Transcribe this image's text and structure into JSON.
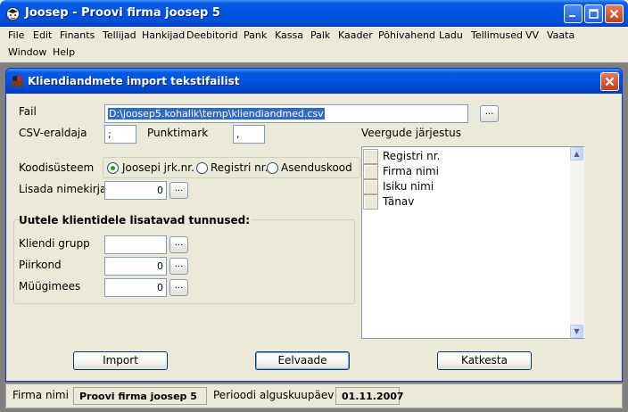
{
  "window": {
    "title": "Joosep - Proovi firma joosep 5"
  },
  "menu": {
    "row1": [
      "File",
      "Edit",
      "Finants",
      "Tellijad",
      "Hankijad",
      "Deebitorid",
      "Pank",
      "Kassa",
      "Palk",
      "Kaader",
      "Põhivahend",
      "Ladu",
      "Tellimused",
      "VV",
      "Vaata"
    ],
    "row2": [
      "Window",
      "Help"
    ]
  },
  "dialog": {
    "title": "Kliendiandmete import tekstifailist",
    "fail_label": "Fail",
    "fail_value": "D:\\joosep5.kohalik\\temp\\kliendiandmed.csv",
    "csv_label": "CSV-eraldaja",
    "csv_value": ";",
    "punkt_label": "Punktimark",
    "punkt_value": ",",
    "kood_label": "Koodisüsteem",
    "kood_options": [
      "Joosepi jrk.nr.",
      "Registri nr.",
      "Asenduskood"
    ],
    "kood_selected": "Joosepi jrk.nr.",
    "nimekiri_label": "Lisada nimekirja",
    "nimekiri_value": "0",
    "group_title": "Uutele klientidele lisatavad tunnused:",
    "grupp_label": "Kliendi grupp",
    "grupp_value": "",
    "piirkond_label": "Piirkond",
    "piirkond_value": "0",
    "myygimees_label": "Müügimees",
    "myygimees_value": "0",
    "columns_label": "Veergude järjestus",
    "columns": [
      "Registri nr.",
      "Firma nimi",
      "Isiku nimi",
      "Tänav"
    ],
    "ellipsis": "...",
    "buttons": {
      "import": "Import",
      "eelvaade": "Eelvaade",
      "katkesta": "Katkesta"
    }
  },
  "status": {
    "firma_label": "Firma nimi",
    "firma_value": "Proovi firma joosep 5",
    "periood_label": "Perioodi alguskuupäev",
    "periood_value": "01.11.2007"
  }
}
